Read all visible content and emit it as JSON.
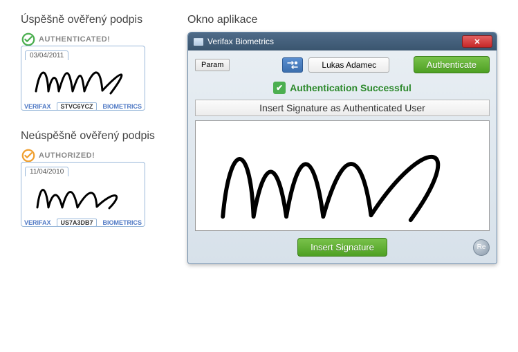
{
  "left": {
    "success_title": "Úspěšně ověřený podpis",
    "fail_title": "Neúspěšně ověřený podpis",
    "cards": [
      {
        "badge": "AUTHENTICATED!",
        "date": "03/04/2011",
        "brand_left": "VERIFAX",
        "brand_right": "BIOMETRICS",
        "code": "STVC6YCZ",
        "ring_color": "#4caf50"
      },
      {
        "badge": "AUTHORIZED!",
        "date": "11/04/2010",
        "brand_left": "VERIFAX",
        "brand_right": "BIOMETRICS",
        "code": "US7A3DB7",
        "ring_color": "#f0a030"
      }
    ]
  },
  "right_title": "Okno aplikace",
  "window": {
    "title": "Verifax Biometrics",
    "close": "✕",
    "param": "Param",
    "user": "Lukas Adamec",
    "authenticate": "Authenticate",
    "status": "Authentication Successful",
    "insert_label": "Insert Signature as Authenticated User",
    "insert_button": "Insert Signature",
    "re": "Re"
  }
}
